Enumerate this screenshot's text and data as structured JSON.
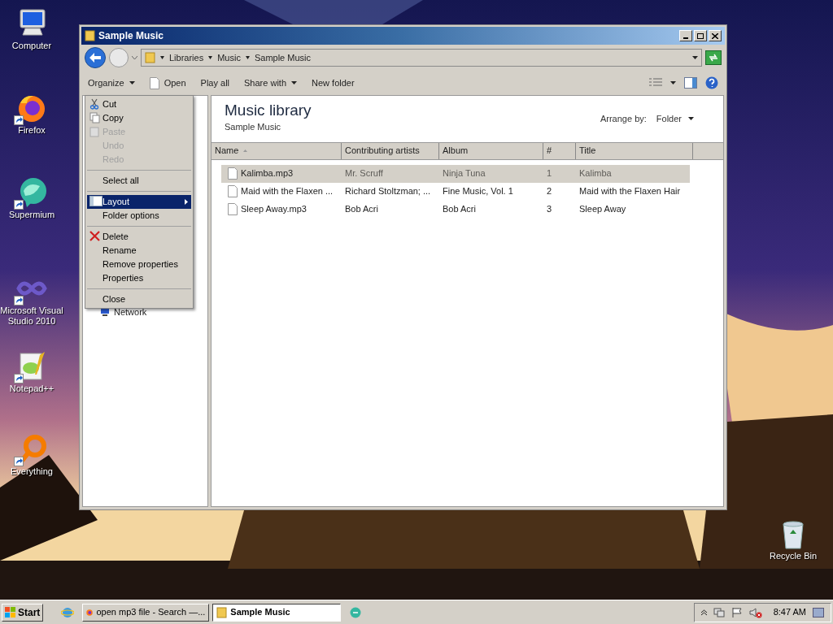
{
  "desktop_icons": [
    {
      "label": "Computer",
      "kind": "computer",
      "shortcut": false
    },
    {
      "label": "Firefox",
      "kind": "firefox",
      "shortcut": true
    },
    {
      "label": "Supermium",
      "kind": "supermium",
      "shortcut": true
    },
    {
      "label": "Microsoft Visual Studio 2010",
      "kind": "vs",
      "shortcut": true
    },
    {
      "label": "Notepad++",
      "kind": "notepad",
      "shortcut": true
    },
    {
      "label": "Everything",
      "kind": "everything",
      "shortcut": true
    },
    {
      "label": "Recycle Bin",
      "kind": "recycle",
      "shortcut": false
    }
  ],
  "window": {
    "title": "Sample Music",
    "breadcrumb": [
      "Libraries",
      "Music",
      "Sample Music"
    ],
    "toolbar": [
      {
        "label": "Organize",
        "kind": "menu"
      },
      {
        "label": "Open",
        "kind": "icon"
      },
      {
        "label": "Play all",
        "kind": "plain"
      },
      {
        "label": "Share with",
        "kind": "menu"
      },
      {
        "label": "New folder",
        "kind": "plain"
      }
    ],
    "nav_items": [
      "Network"
    ],
    "library": {
      "title": "Music library",
      "subtitle": "Sample Music",
      "arrange_label": "Arrange by:",
      "arrange_value": "Folder"
    },
    "columns": [
      "Name",
      "Contributing artists",
      "Album",
      "#",
      "Title"
    ],
    "rows": [
      {
        "selected": true,
        "cells": [
          "Kalimba.mp3",
          "Mr. Scruff",
          "Ninja Tuna",
          "1",
          "Kalimba"
        ]
      },
      {
        "selected": false,
        "cells": [
          "Maid with the Flaxen ...",
          "Richard Stoltzman; ...",
          "Fine Music, Vol. 1",
          "2",
          "Maid with the Flaxen Hair"
        ]
      },
      {
        "selected": false,
        "cells": [
          "Sleep Away.mp3",
          "Bob Acri",
          "Bob Acri",
          "3",
          "Sleep Away"
        ]
      }
    ]
  },
  "menu": [
    [
      {
        "label": "Cut",
        "kind": "cut",
        "disabled": false,
        "selected": false,
        "submenu": false
      },
      {
        "label": "Copy",
        "kind": "copy",
        "disabled": false,
        "selected": false,
        "submenu": false
      },
      {
        "label": "Paste",
        "kind": "paste",
        "disabled": true,
        "selected": false,
        "submenu": false
      },
      {
        "label": "Undo",
        "kind": "plain",
        "disabled": true,
        "selected": false,
        "submenu": false
      },
      {
        "label": "Redo",
        "kind": "plain",
        "disabled": true,
        "selected": false,
        "submenu": false
      }
    ],
    [
      {
        "label": "Select all",
        "kind": "plain",
        "disabled": false,
        "selected": false,
        "submenu": false
      }
    ],
    [
      {
        "label": "Layout",
        "kind": "layout",
        "disabled": false,
        "selected": true,
        "submenu": true
      },
      {
        "label": "Folder options",
        "kind": "plain",
        "disabled": false,
        "selected": false,
        "submenu": false
      }
    ],
    [
      {
        "label": "Delete",
        "kind": "delete",
        "disabled": false,
        "selected": false,
        "submenu": false
      },
      {
        "label": "Rename",
        "kind": "plain",
        "disabled": false,
        "selected": false,
        "submenu": false
      },
      {
        "label": "Remove properties",
        "kind": "plain",
        "disabled": false,
        "selected": false,
        "submenu": false
      },
      {
        "label": "Properties",
        "kind": "plain",
        "disabled": false,
        "selected": false,
        "submenu": false
      }
    ],
    [
      {
        "label": "Close",
        "kind": "plain",
        "disabled": false,
        "selected": false,
        "submenu": false
      }
    ]
  ],
  "taskbar": {
    "start": "Start",
    "items": [
      {
        "kind": "ie"
      },
      {
        "label": "open mp3 file - Search —...",
        "kind": "firefox",
        "selected": false
      },
      {
        "label": "Sample Music",
        "kind": "folder",
        "selected": true
      },
      {
        "kind": "supermium"
      }
    ],
    "clock": "8:47 AM"
  }
}
